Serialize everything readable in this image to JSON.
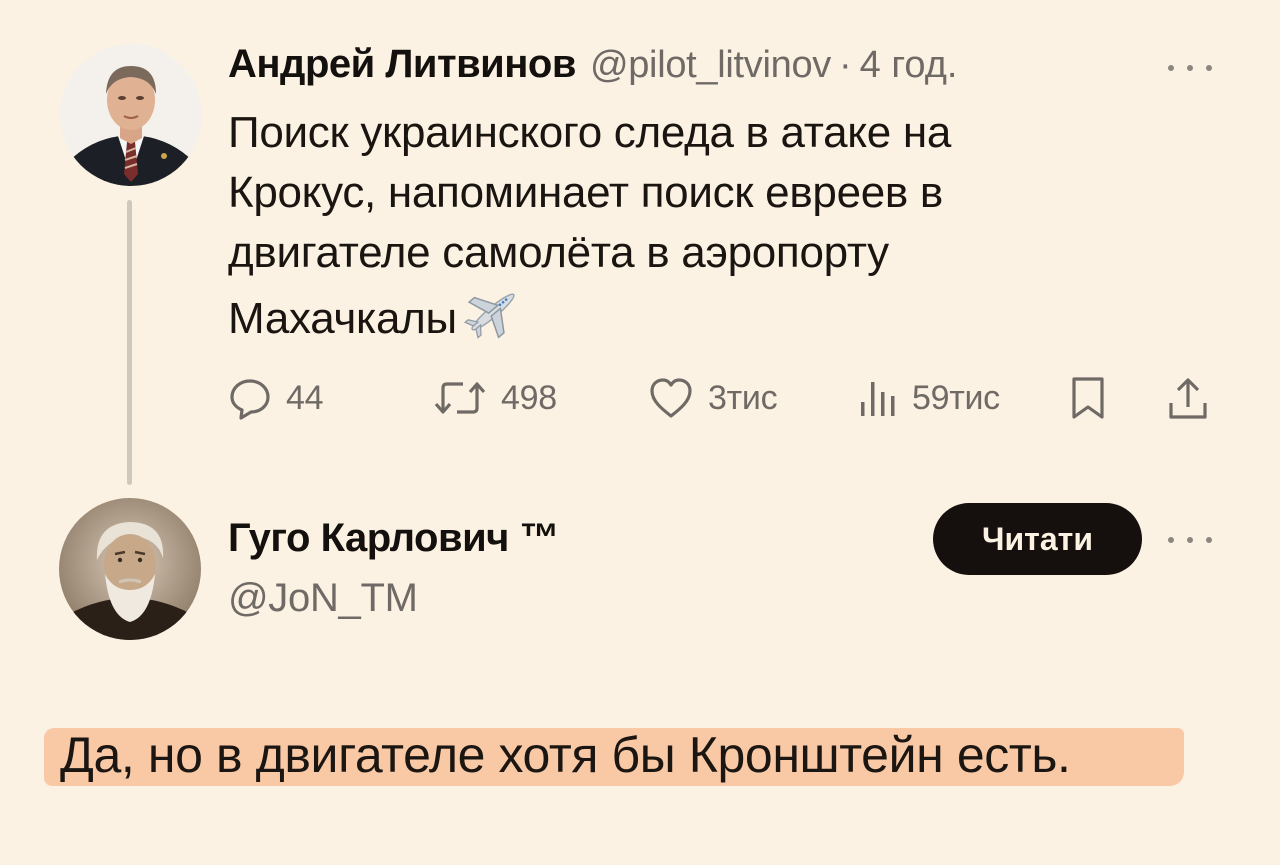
{
  "tweet": {
    "author_name": "Андрей Литвинов",
    "handle": "@pilot_litvinov",
    "separator": "·",
    "time": "4 год.",
    "text_lines": [
      "Поиск украинского следа в атаке на",
      "Крокус, напоминает поиск евреев в",
      "двигателе самолёта в аэропорту",
      "Махачкалы"
    ],
    "emoji": "airplane-icon",
    "actions": {
      "replies": "44",
      "retweets": "498",
      "likes": "3тис",
      "views": "59тис"
    }
  },
  "profile": {
    "name": "Гуго Карлович ™",
    "handle": "@JoN_TM",
    "follow_label": "Читати"
  },
  "reply_caption": "Да, но в двигателе хотя бы Кронштейн есть.",
  "icons": [
    "more-icon",
    "reply-icon",
    "retweet-icon",
    "like-icon",
    "views-icon",
    "bookmark-icon",
    "share-icon",
    "airplane-icon"
  ],
  "colors": {
    "background": "#fbf2e3",
    "text": "#14100d",
    "muted": "#6f6a65",
    "button": "#15100d",
    "highlight": "#f9c9a6"
  }
}
